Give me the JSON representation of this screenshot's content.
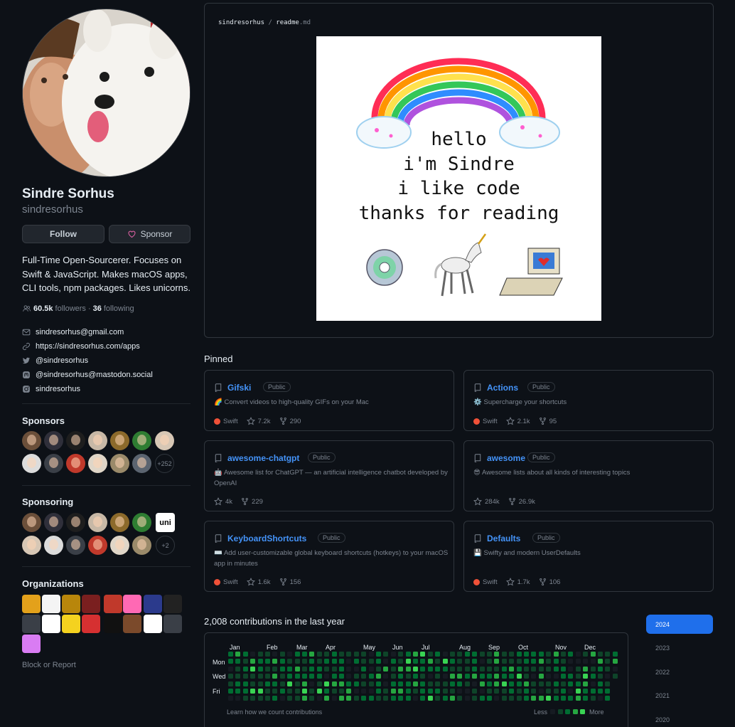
{
  "profile": {
    "fullname": "Sindre Sorhus",
    "login": "sindresorhus",
    "follow_label": "Follow",
    "sponsor_label": "Sponsor",
    "bio": "Full-Time Open-Sourcerer. Focuses on Swift & JavaScript. Makes macOS apps, CLI tools, npm packages. Likes unicorns.",
    "followers": "60.5k",
    "followers_label": "followers",
    "separator": "·",
    "following": "36",
    "following_label": "following",
    "links": [
      {
        "icon": "mail-icon",
        "text": "sindresorhus@gmail.com"
      },
      {
        "icon": "link-icon",
        "text": "https://sindresorhus.com/apps"
      },
      {
        "icon": "twitter-icon",
        "text": "@sindresorhus"
      },
      {
        "icon": "mastodon-icon",
        "text": "@sindresorhus@mastodon.social"
      },
      {
        "icon": "instagram-icon",
        "text": "sindresorhus"
      }
    ],
    "block_report": "Block or Report"
  },
  "sponsors": {
    "title": "Sponsors",
    "more": "+252"
  },
  "sponsoring": {
    "title": "Sponsoring",
    "more": "+2",
    "uni_label": "uni"
  },
  "organizations": {
    "title": "Organizations"
  },
  "readme": {
    "owner": "sindresorhus",
    "slash": "/",
    "file": "readme",
    "ext": ".md",
    "lines": [
      "hello",
      "i'm Sindre",
      "i like code",
      "thanks for reading"
    ]
  },
  "pinned": {
    "title": "Pinned",
    "items": [
      {
        "name": "Gifski",
        "visibility": "Public",
        "emoji": "🌈",
        "desc": "Convert videos to high-quality GIFs on your Mac",
        "lang": "Swift",
        "stars": "7.2k",
        "forks": "290"
      },
      {
        "name": "Actions",
        "visibility": "Public",
        "emoji": "⚙️",
        "desc": "Supercharge your shortcuts",
        "lang": "Swift",
        "stars": "2.1k",
        "forks": "95"
      },
      {
        "name": "awesome-chatgpt",
        "visibility": "Public",
        "emoji": "🤖",
        "desc": "Awesome list for ChatGPT — an artificial intelligence chatbot developed by OpenAI",
        "lang": "",
        "stars": "4k",
        "forks": "229"
      },
      {
        "name": "awesome",
        "visibility": "Public",
        "emoji": "😎",
        "desc": "Awesome lists about all kinds of interesting topics",
        "lang": "",
        "stars": "284k",
        "forks": "26.9k"
      },
      {
        "name": "KeyboardShortcuts",
        "visibility": "Public",
        "emoji": "⌨️",
        "desc": "Add user-customizable global keyboard shortcuts (hotkeys) to your macOS app in minutes",
        "lang": "Swift",
        "stars": "1.6k",
        "forks": "156"
      },
      {
        "name": "Defaults",
        "visibility": "Public",
        "emoji": "💾",
        "desc": "Swifty and modern UserDefaults",
        "lang": "Swift",
        "stars": "1.7k",
        "forks": "106"
      }
    ]
  },
  "contributions": {
    "title": "2,008 contributions in the last year",
    "months": [
      "Jan",
      "Feb",
      "Mar",
      "Apr",
      "May",
      "Jun",
      "Jul",
      "Aug",
      "Sep",
      "Oct",
      "Nov",
      "Dec"
    ],
    "days": [
      "Mon",
      "Wed",
      "Fri"
    ],
    "learn": "Learn how we count contributions",
    "less": "Less",
    "more": "More",
    "colors": [
      "#161b22",
      "#0e4429",
      "#006d32",
      "#26a641",
      "#39d353"
    ]
  },
  "years": [
    "2024",
    "2023",
    "2022",
    "2021",
    "2020"
  ],
  "colors": {
    "accent": "#4493f8",
    "swift": "#f05138",
    "bg": "#0d1117",
    "border": "#30363d"
  }
}
